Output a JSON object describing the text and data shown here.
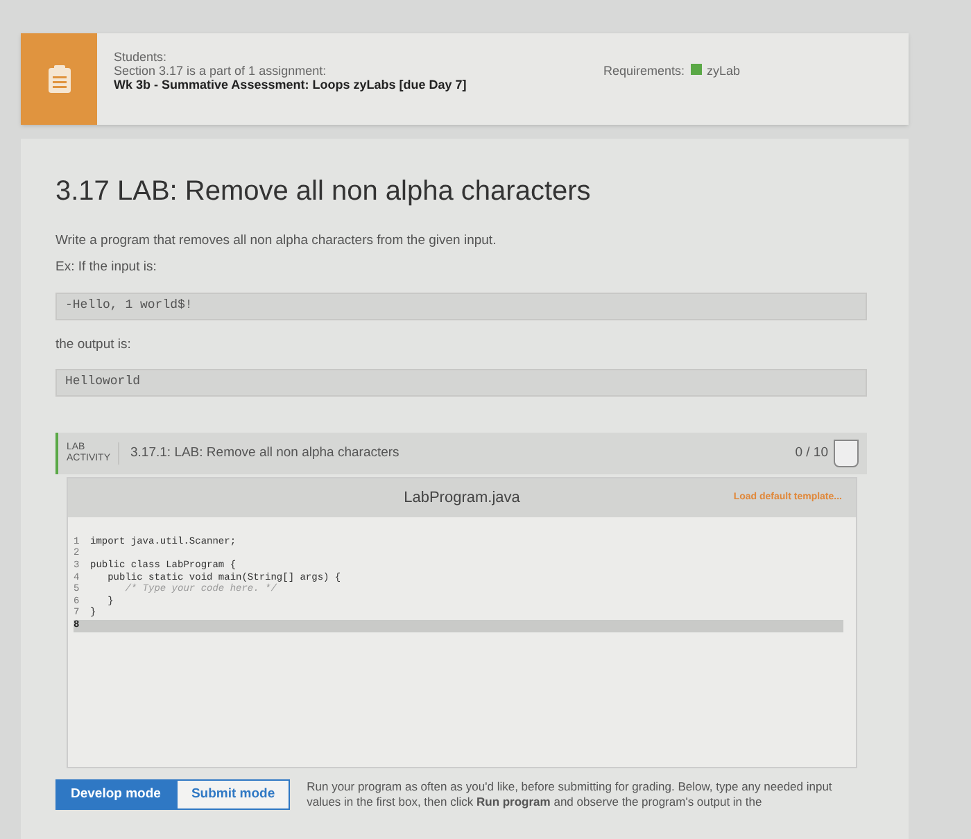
{
  "assignment": {
    "lines": [
      "Students:",
      "Section 3.17 is a part of 1 assignment:"
    ],
    "title": "Wk 3b - Summative Assessment: Loops zyLabs [due Day 7]",
    "requirements_label": "Requirements:",
    "requirement": {
      "label": "zyLab",
      "color": "#5aa846"
    }
  },
  "section": {
    "title": "3.17 LAB: Remove all non alpha characters",
    "paragraphs": [
      "Write a program that removes all non alpha characters from the given input.",
      "Ex: If the input is:"
    ],
    "example_input": "-Hello, 1 world$!",
    "output_label": "the output is:",
    "example_output": "Helloworld"
  },
  "activity": {
    "badge_lines": [
      "LAB",
      "ACTIVITY"
    ],
    "title": "3.17.1: LAB: Remove all non alpha characters",
    "score": "0 / 10"
  },
  "editor": {
    "filename": "LabProgram.java",
    "load_template": "Load default template...",
    "lines": [
      {
        "number": "1",
        "code": "import java.util.Scanner;",
        "active": false
      },
      {
        "number": "2",
        "active": false
      },
      {
        "number": "3",
        "code": "public class LabProgram {",
        "active": false
      },
      {
        "number": "4",
        "code": "   public static void main(String[] args) {",
        "active": false
      },
      {
        "number": "5",
        "code": "      /* Type your code here. */",
        "active": false
      },
      {
        "number": "6",
        "code": "   }",
        "active": false
      },
      {
        "number": "7",
        "code": "}",
        "active": false
      },
      {
        "number": "8",
        "active": true
      }
    ]
  },
  "modes": [
    {
      "label": "Develop mode",
      "selected": true
    },
    {
      "label": "Submit mode",
      "selected": false
    }
  ],
  "instructions": "Run your program as often as you'd like, before submitting for grading. Below, type any needed input values in the first box, then click **Run program** and observe the program's output in the"
}
